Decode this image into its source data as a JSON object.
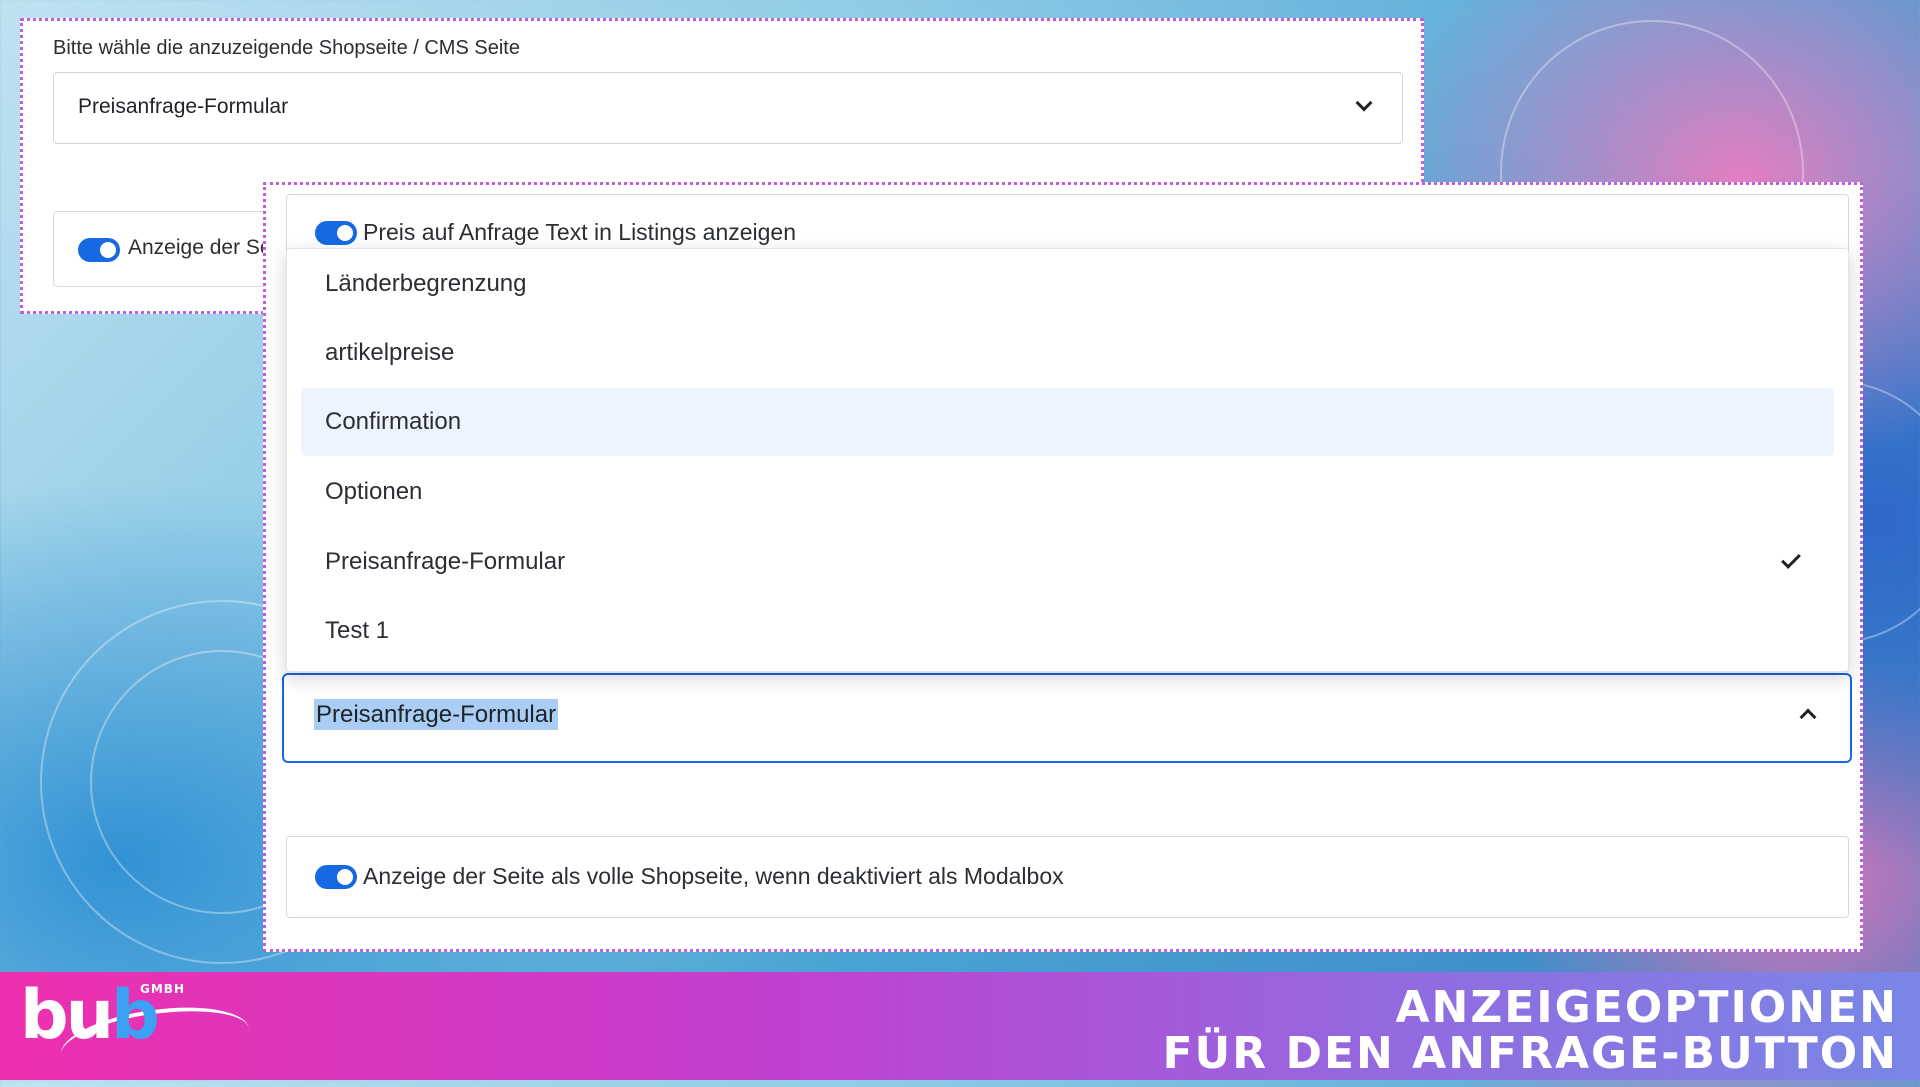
{
  "background_frame": {
    "label": "Bitte wähle die anzuzeigende Shopseite / CMS Seite",
    "select_value": "Preisanfrage-Formular",
    "toggle_label": "Anzeige der Se"
  },
  "front_frame": {
    "listing_toggle_label": "Preis auf Anfrage Text in Listings anzeigen",
    "dropdown": {
      "options": [
        {
          "label": "Länderbegrenzung",
          "highlighted": false,
          "selected": false
        },
        {
          "label": "artikelpreise",
          "highlighted": false,
          "selected": false
        },
        {
          "label": "Confirmation",
          "highlighted": true,
          "selected": false
        },
        {
          "label": "Optionen",
          "highlighted": false,
          "selected": false
        },
        {
          "label": "Preisanfrage-Formular",
          "highlighted": false,
          "selected": true
        },
        {
          "label": "Test 1",
          "highlighted": false,
          "selected": false
        }
      ]
    },
    "select_value": "Preisanfrage-Formular",
    "fullpage_toggle_label": "Anzeige der Seite als volle Shopseite, wenn deaktiviert als Modalbox"
  },
  "footer": {
    "logo_main": "bu",
    "logo_accent": "b",
    "logo_suffix": "GMBH",
    "headline_line1": "ANZEIGEOPTIONEN",
    "headline_line2": "FÜR DEN ANFRAGE-BUTTON"
  },
  "colors": {
    "accent": "#1668e3",
    "frame_border": "#c15ee0",
    "footer_gradient_start": "#ee2fae",
    "footer_gradient_end": "#7a86e6"
  },
  "icons": {
    "chevron_down": "chevron-down-icon",
    "chevron_up": "chevron-up-icon",
    "checkmark": "checkmark-icon"
  }
}
